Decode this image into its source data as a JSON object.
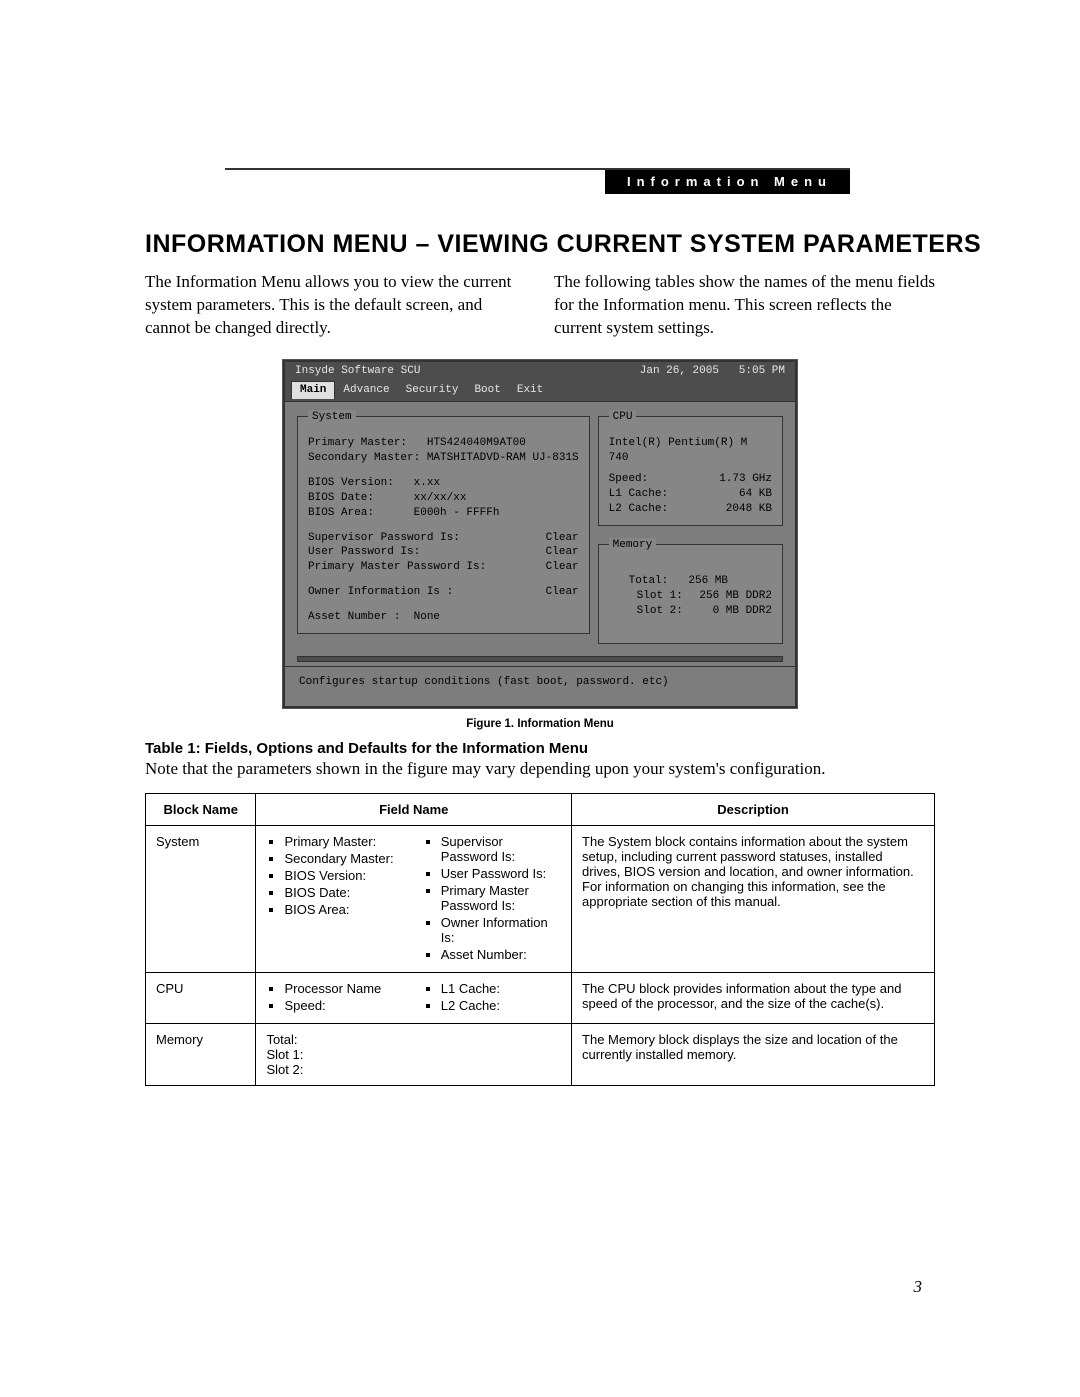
{
  "section_tag": "Information Menu",
  "page_number": "3",
  "heading": "INFORMATION MENU – VIEWING CURRENT SYSTEM PARAMETERS",
  "intro": {
    "left": "The Information Menu allows you to view the current system parameters. This is the default screen, and cannot be changed directly.",
    "right": "The following tables show the names of the menu fields for the Information menu. This screen reflects the current system settings."
  },
  "bios": {
    "title": "Insyde Software SCU",
    "date": "Jan 26, 2005",
    "time": "5:05 PM",
    "menu": [
      "Main",
      "Advance",
      "Security",
      "Boot",
      "Exit"
    ],
    "menu_active_index": 0,
    "status_line": "Configures startup conditions (fast boot, password. etc)",
    "system": {
      "legend": "System",
      "primary_master_label": "Primary Master:",
      "primary_master_value": "HTS424040M9AT00",
      "secondary_master_label": "Secondary Master:",
      "secondary_master_value": "MATSHITADVD-RAM UJ-831S",
      "bios_version_label": "BIOS Version:",
      "bios_version_value": "x.xx",
      "bios_date_label": "BIOS Date:",
      "bios_date_value": "xx/xx/xx",
      "bios_area_label": "BIOS Area:",
      "bios_area_value": "E000h - FFFFh",
      "supervisor_pw_label": "Supervisor Password Is:",
      "supervisor_pw_value": "Clear",
      "user_pw_label": "User Password Is:",
      "user_pw_value": "Clear",
      "primary_master_pw_label": "Primary Master Password Is:",
      "primary_master_pw_value": "Clear",
      "owner_info_label": "Owner Information Is :",
      "owner_info_value": "Clear",
      "asset_number_label": "Asset Number :",
      "asset_number_value": "None"
    },
    "cpu": {
      "legend": "CPU",
      "name": "Intel(R) Pentium(R)  M 740",
      "speed_label": "Speed:",
      "speed_value": "1.73 GHz",
      "l1_label": "L1 Cache:",
      "l1_value": "64 KB",
      "l2_label": "L2 Cache:",
      "l2_value": "2048 KB"
    },
    "memory": {
      "legend": "Memory",
      "total_label": "Total:",
      "total_value": "256 MB",
      "slot1_label": "Slot 1:",
      "slot1_value": "256 MB DDR2",
      "slot2_label": "Slot 2:",
      "slot2_value": "0 MB DDR2"
    }
  },
  "figure_caption": "Figure 1.  Information Menu",
  "table_title": "Table 1: Fields, Options and Defaults for the Information Menu",
  "table_note": "Note that the parameters shown in the figure may vary depending upon your system's configuration.",
  "table": {
    "headers": {
      "block": "Block Name",
      "field": "Field Name",
      "desc": "Description"
    },
    "rows": [
      {
        "block": "System",
        "fields_a": [
          "Primary Master:",
          "Secondary Master:",
          "BIOS Version:",
          "BIOS Date:",
          "BIOS Area:"
        ],
        "fields_b": [
          "Supervisor Password Is:",
          "User Password Is:",
          "Primary Master Password Is:",
          "Owner Information Is:",
          "Asset Number:"
        ],
        "desc": "The System block contains information about the system setup, including current password statuses, installed drives, BIOS version and location, and owner information. For information on changing this information, see the appropriate section of this manual."
      },
      {
        "block": "CPU",
        "fields_a": [
          "Processor Name",
          "Speed:"
        ],
        "fields_b": [
          "L1 Cache:",
          "L2 Cache:"
        ],
        "desc": "The CPU block provides information about the type and speed of the processor, and the size of the cache(s)."
      },
      {
        "block": "Memory",
        "fields_plain": "Total:\nSlot 1:\nSlot 2:",
        "desc": "The Memory block displays the size and location of the currently installed memory."
      }
    ]
  }
}
